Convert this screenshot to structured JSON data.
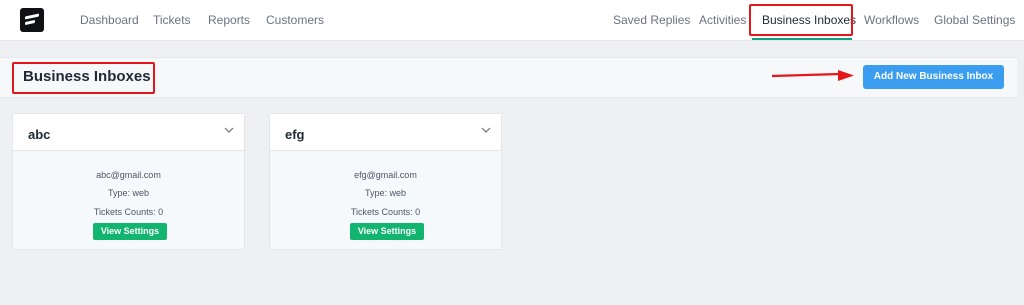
{
  "nav": {
    "left": [
      "Dashboard",
      "Tickets",
      "Reports",
      "Customers"
    ],
    "right": [
      "Saved Replies",
      "Activities",
      "Business Inboxes",
      "Workflows",
      "Global Settings"
    ],
    "active": "Business Inboxes"
  },
  "header": {
    "title": "Business Inboxes",
    "add_button": "Add New Business Inbox"
  },
  "inboxes": [
    {
      "name": "abc",
      "email": "abc@gmail.com",
      "type": "Type: web",
      "tickets": "Tickets Counts: 0",
      "button": "View Settings"
    },
    {
      "name": "efg",
      "email": "efg@gmail.com",
      "type": "Type: web",
      "tickets": "Tickets Counts: 0",
      "button": "View Settings"
    }
  ],
  "colors": {
    "accent_green": "#12b56f",
    "primary_blue": "#3a9df0",
    "annotation_red": "#e3171c",
    "active_underline": "#12a37a"
  },
  "icons": [
    "logo-icon",
    "chevron-down-icon",
    "red-arrow-annotation"
  ]
}
